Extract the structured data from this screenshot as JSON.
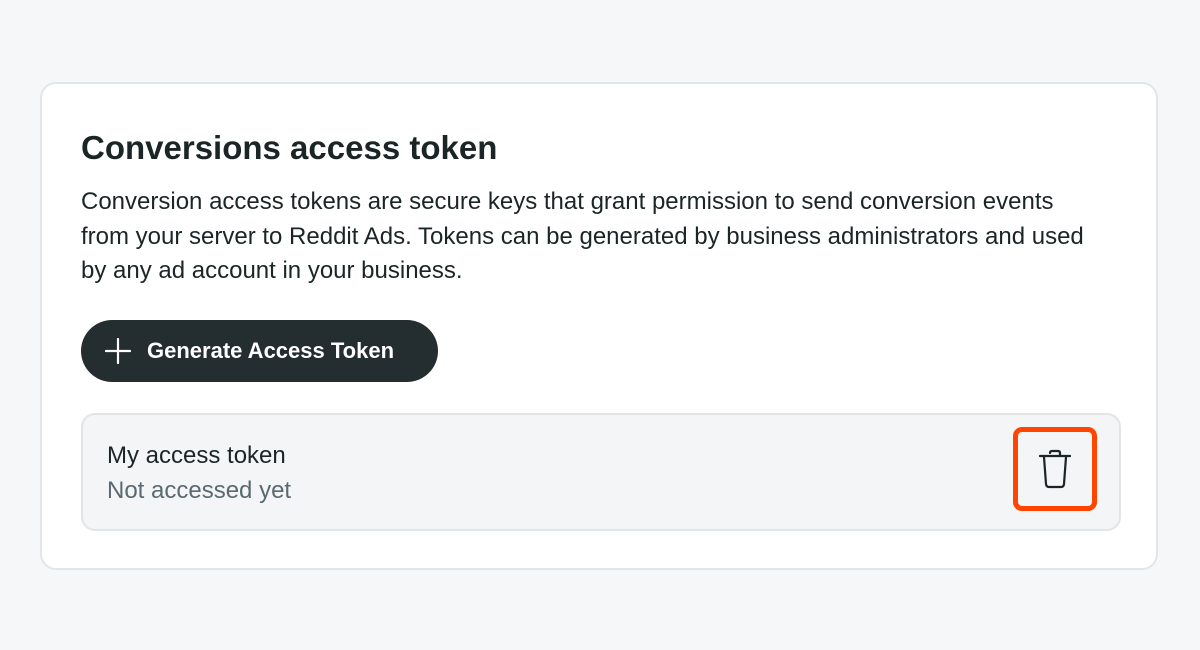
{
  "section": {
    "title": "Conversions access token",
    "description": "Conversion access tokens are secure keys that grant permission to send conversion events from your server to Reddit Ads. Tokens can be generated by business administrators and used by any ad account in your business."
  },
  "generate_button": {
    "label": "Generate Access Token",
    "icon": "plus-icon"
  },
  "tokens": [
    {
      "name": "My access token",
      "status": "Not accessed yet",
      "action_icon": "trash-icon"
    }
  ],
  "colors": {
    "button_bg": "#242d2f",
    "highlight": "#ff4500",
    "text_primary": "#1c2526",
    "text_secondary": "#5b6a71"
  }
}
